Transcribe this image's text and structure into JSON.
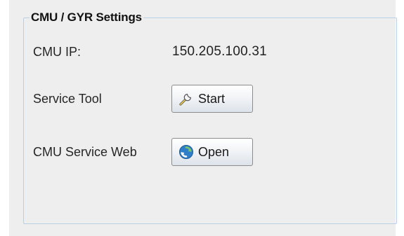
{
  "group": {
    "title": "CMU / GYR Settings"
  },
  "cmu_ip": {
    "label": "CMU IP:",
    "value": "150.205.100.31"
  },
  "service_tool": {
    "label": "Service Tool",
    "button_label": "Start",
    "button_icon": "wrench-icon"
  },
  "service_web": {
    "label": "CMU Service Web",
    "button_label": "Open",
    "button_icon": "browser-refresh-icon"
  },
  "colors": {
    "panel_background": "#eeeeee",
    "group_border": "#b9d0e4",
    "button_border": "#8c8c8c"
  }
}
